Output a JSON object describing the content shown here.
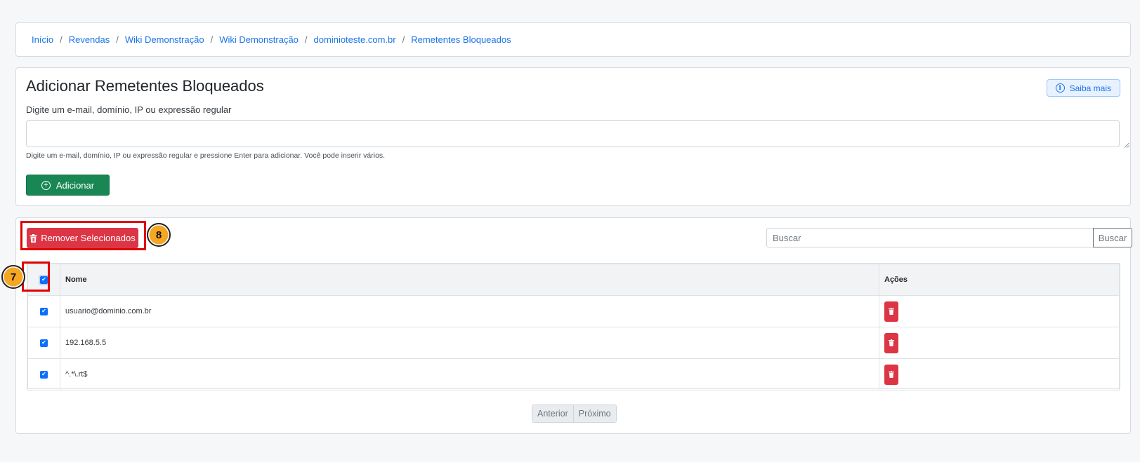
{
  "breadcrumb": {
    "items": [
      "Início",
      "Revendas",
      "Wiki Demonstração",
      "Wiki Demonstração",
      "dominioteste.com.br",
      "Remetentes Bloqueados"
    ],
    "separator": "/"
  },
  "add_form": {
    "title": "Adicionar Remetentes Bloqueados",
    "help_button_label": "Saiba mais",
    "field_label": "Digite um e-mail, domínio, IP ou expressão regular",
    "field_value": "",
    "help_text": "Digite um e-mail, domínio, IP ou expressão regular e pressione Enter para adicionar. Você pode inserir vários.",
    "submit_label": "Adicionar"
  },
  "list": {
    "remove_selected_label": "Remover Selecionados",
    "search_placeholder": "Buscar",
    "search_button_label": "Buscar",
    "columns": [
      "Nome",
      "Ações"
    ],
    "select_all_checked": true,
    "rows": [
      {
        "name": "usuario@dominio.com.br",
        "checked": true
      },
      {
        "name": "192.168.5.5",
        "checked": true
      },
      {
        "name": "^.*\\.rt$",
        "checked": true
      }
    ],
    "pagination": {
      "prev": "Anterior",
      "next": "Próximo"
    }
  },
  "annotations": [
    {
      "number": "7",
      "target": "select-all-checkbox"
    },
    {
      "number": "8",
      "target": "remove-selected-button"
    }
  ],
  "colors": {
    "link": "#1a73e8",
    "success": "#198754",
    "danger": "#dc3545",
    "primary": "#0d6efd",
    "highlight": "#e00000",
    "badge": "#f5a623"
  }
}
